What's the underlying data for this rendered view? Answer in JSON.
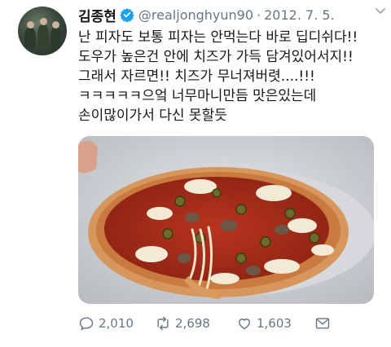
{
  "tweet": {
    "author_name": "김종현",
    "author_handle": "@realjonghyun90",
    "separator": "·",
    "date": "2012. 7. 5.",
    "verified": true,
    "text_lines": [
      "난 피자도 보통 피자는 안먹는다 바로 딥디쉬다!!",
      "도우가 높은건 안에 치즈가 가득 담겨있어서지!!",
      "그래서 자르면!! 치즈가 무너져버렷....!!!",
      "ㅋㅋㅋㅋㅋ으엌 너무마니만듬 맛은있는데",
      "손이많이가서 다신 못할듯"
    ],
    "media": {
      "subject": "deep dish pizza photo"
    }
  },
  "actions": {
    "reply_count": "2,010",
    "retweet_count": "2,698",
    "like_count": "1,603"
  },
  "icons": {
    "verified": "verified-badge-icon",
    "menu": "chevron-down-icon",
    "reply": "reply-icon",
    "retweet": "retweet-icon",
    "like": "heart-icon",
    "dm": "direct-message-icon"
  },
  "colors": {
    "verified_blue": "#1da1f2",
    "secondary_text": "#657786",
    "primary_text": "#14171a"
  }
}
